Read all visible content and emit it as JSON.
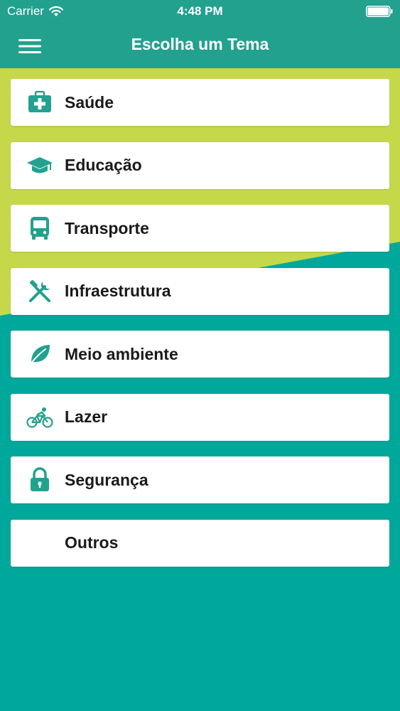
{
  "status_bar": {
    "carrier": "Carrier",
    "time": "4:48 PM",
    "wifi_icon": "wifi-icon",
    "battery_icon": "battery-icon"
  },
  "nav": {
    "title": "Escolha um Tema",
    "menu_icon": "hamburger-menu-icon"
  },
  "colors": {
    "primary": "#22a18f",
    "teal_background": "#00a89c",
    "lime_accent": "#c5d84a",
    "card": "#ffffff",
    "icon": "#22a18f"
  },
  "topics": [
    {
      "label": "Saúde",
      "icon": "first-aid-kit-icon"
    },
    {
      "label": "Educação",
      "icon": "graduation-cap-icon"
    },
    {
      "label": "Transporte",
      "icon": "bus-icon"
    },
    {
      "label": "Infraestrutura",
      "icon": "tools-icon"
    },
    {
      "label": "Meio ambiente",
      "icon": "leaf-icon"
    },
    {
      "label": "Lazer",
      "icon": "bicycle-icon"
    },
    {
      "label": "Segurança",
      "icon": "lock-icon"
    },
    {
      "label": "Outros",
      "icon": ""
    }
  ]
}
